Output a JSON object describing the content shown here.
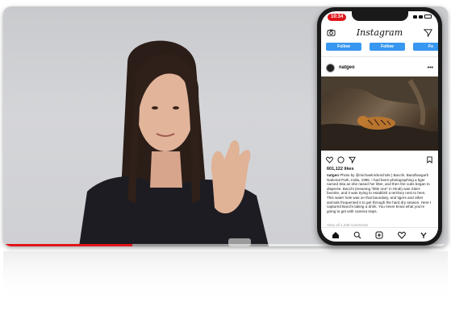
{
  "video": {
    "progress_percent": 29,
    "progress_color": "#e0151b"
  },
  "phone": {
    "status_time": "10:34",
    "app_logo": "Instagram",
    "follow_buttons": [
      "Follow",
      "Follow",
      "Fo"
    ],
    "post": {
      "username": "natgeo",
      "likes": "601,122 likes",
      "caption_user": "natgeo",
      "caption_text": "Photo by @michaelnicknichols | Bacchi, Bandhavgarh National Park, India, 1996. I had been photographing a tiger named Sita as she raised her litter, and then the cubs began to disperse. Bacchi (meaning \"little one\" in Hindi) was Sita's favorite, and it was trying to establish a territory next to hers. This water hole was on that boundary, and tigers and other animals frequented it to get through the hard dry season. Here I captured Bacchi taking a drink. You never know what you're going to get with camera traps.",
      "view_comments": "View all 1,236 comments"
    },
    "icons": {
      "header_left": "camera-icon",
      "header_right": "send-icon",
      "actions": [
        "heart-icon",
        "comment-icon",
        "share-icon",
        "bookmark-icon"
      ],
      "tabs": [
        "home-icon",
        "search-icon",
        "add-post-icon",
        "heart-icon",
        "profile-icon"
      ]
    }
  }
}
